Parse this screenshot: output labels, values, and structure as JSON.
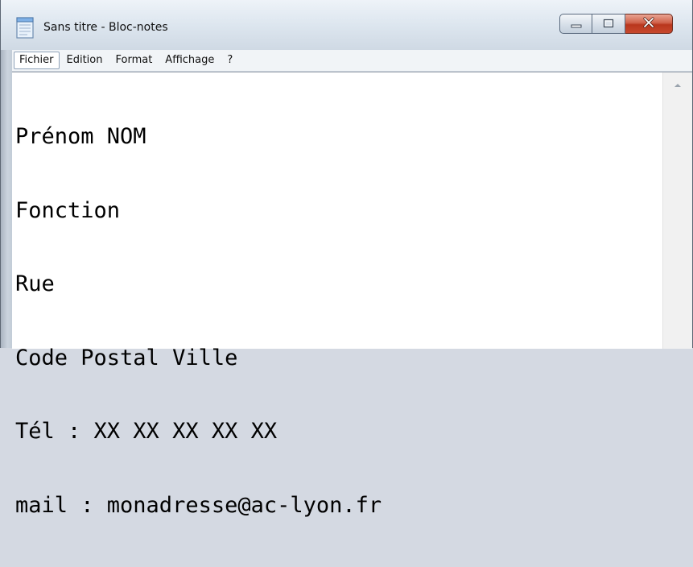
{
  "window": {
    "title": "Sans titre - Bloc-notes",
    "app_icon": "notepad-icon",
    "controls": {
      "minimize_icon": "minimize-icon",
      "maximize_icon": "maximize-icon",
      "close_icon": "close-icon"
    }
  },
  "menubar": {
    "items": [
      {
        "label": "Fichier",
        "active": true
      },
      {
        "label": "Edition"
      },
      {
        "label": "Format"
      },
      {
        "label": "Affichage"
      },
      {
        "label": "?"
      }
    ]
  },
  "editor": {
    "lines": [
      "Prénom NOM",
      "Fonction",
      "Rue",
      "Code Postal Ville",
      "Tél : XX XX XX XX XX",
      "mail : monadresse@ac-lyon.fr"
    ]
  },
  "scrollbar": {
    "up_icon": "scroll-up-arrow-icon"
  },
  "colors": {
    "close_button": "#c7482d",
    "chrome": "#dde6ef",
    "editor_bg": "#ffffff"
  }
}
